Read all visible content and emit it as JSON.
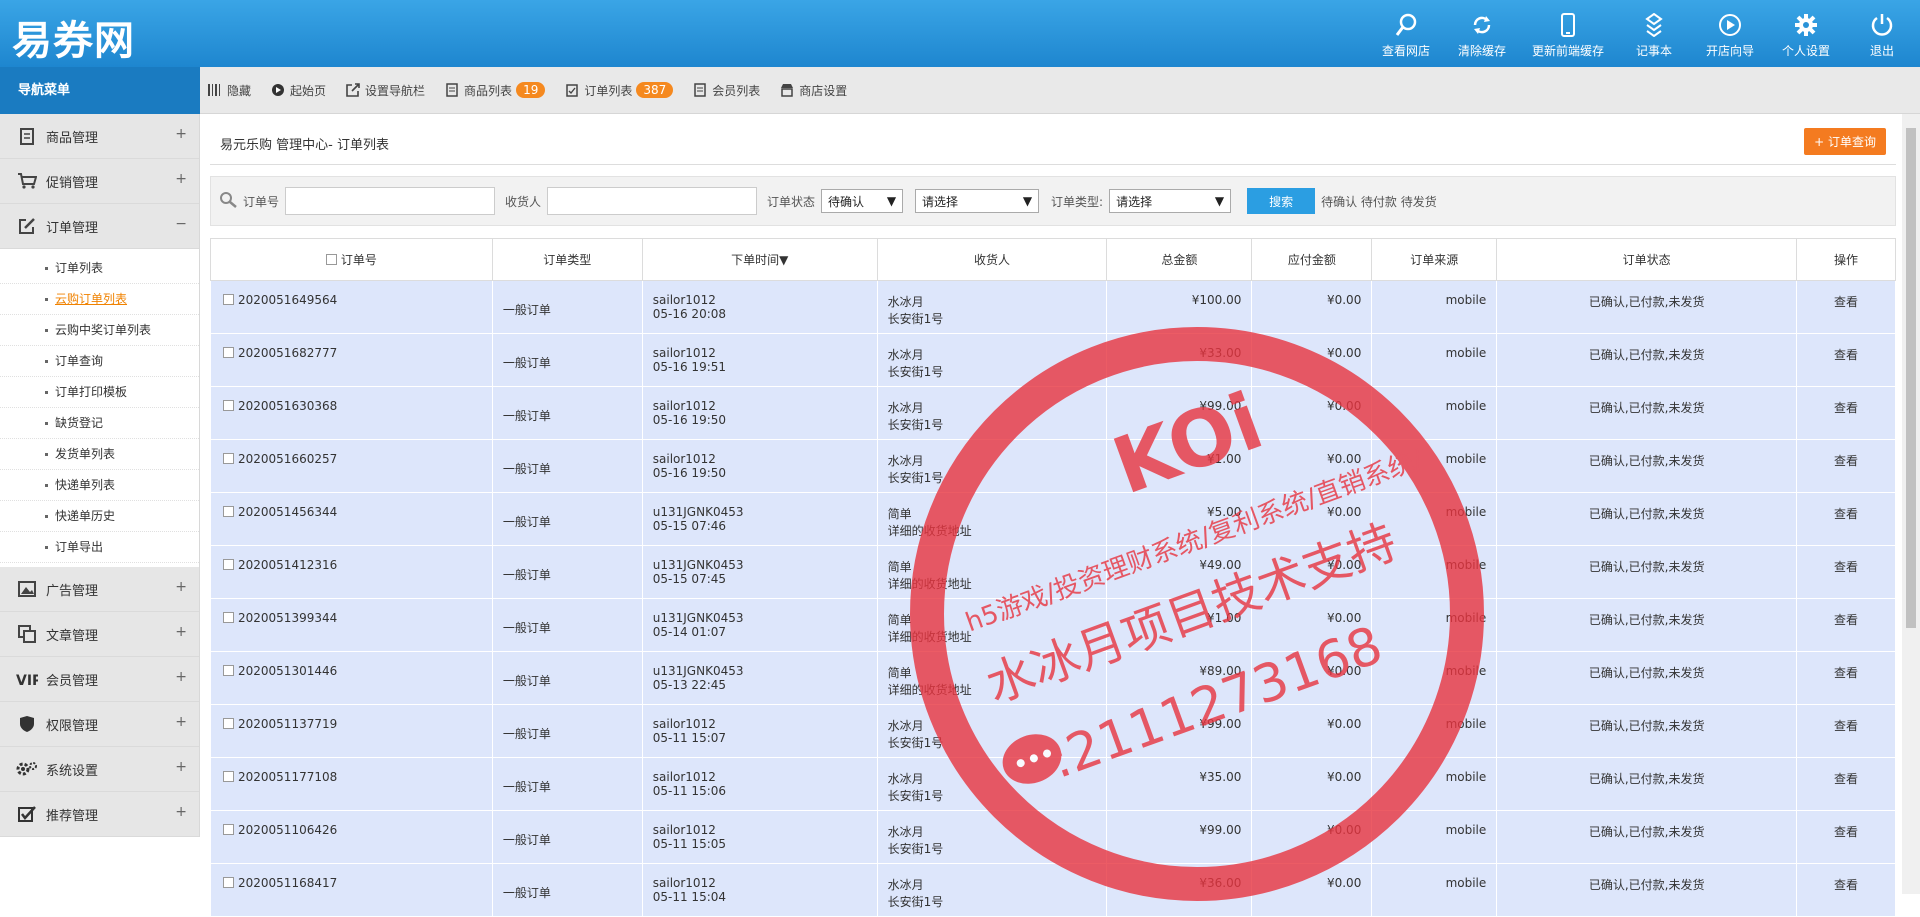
{
  "app": {
    "logo": "易券网"
  },
  "topnav": [
    {
      "label": "查看网店",
      "icon": "search-icon"
    },
    {
      "label": "清除缓存",
      "icon": "refresh-icon"
    },
    {
      "label": "更新前端缓存",
      "icon": "mobile-icon"
    },
    {
      "label": "记事本",
      "icon": "note-icon"
    },
    {
      "label": "开店向导",
      "icon": "play-icon"
    },
    {
      "label": "个人设置",
      "icon": "gear-icon"
    },
    {
      "label": "退出",
      "icon": "power-icon"
    }
  ],
  "sidebar": {
    "title": "导航菜单",
    "items": [
      {
        "label": "商品管理",
        "toggle": "+"
      },
      {
        "label": "促销管理",
        "toggle": "+"
      },
      {
        "label": "订单管理",
        "toggle": "−"
      },
      {
        "label": "广告管理",
        "toggle": "+"
      },
      {
        "label": "文章管理",
        "toggle": "+"
      },
      {
        "label": "会员管理",
        "toggle": "+"
      },
      {
        "label": "权限管理",
        "toggle": "+"
      },
      {
        "label": "系统设置",
        "toggle": "+"
      },
      {
        "label": "推荐管理",
        "toggle": "+"
      }
    ],
    "order_sub": [
      "订单列表",
      "云购订单列表",
      "云购中奖订单列表",
      "订单查询",
      "订单打印模板",
      "缺货登记",
      "发货单列表",
      "快递单列表",
      "快递单历史",
      "订单导出"
    ],
    "active_sub": "云购订单列表"
  },
  "tabs": [
    {
      "label": "隐藏"
    },
    {
      "label": "起始页"
    },
    {
      "label": "设置导航栏"
    },
    {
      "label": "商品列表",
      "badge": "19"
    },
    {
      "label": "订单列表",
      "badge": "387"
    },
    {
      "label": "会员列表"
    },
    {
      "label": "商店设置"
    }
  ],
  "page": {
    "breadcrumb": "易元乐购 管理中心- 订单列表",
    "query_button": "+ 订单查询"
  },
  "filter": {
    "order_no_label": "订单号",
    "consignee_label": "收货人",
    "status_label": "订单状态",
    "status_value": "待确认",
    "select2_value": "请选择",
    "type_label": "订单类型:",
    "type_value": "请选择",
    "search_button": "搜索",
    "quick_links": "待确认 待付款 待发货"
  },
  "table": {
    "headers": [
      "订单号",
      "订单类型",
      "下单时间▼",
      "收货人",
      "总金额",
      "应付金额",
      "订单来源",
      "订单状态",
      "操作"
    ],
    "rows": [
      {
        "no": "2020051649564",
        "type": "一般订单",
        "user": "sailor1012",
        "time": "05-16 20:08",
        "name": "水冰月",
        "addr": "长安街1号",
        "total": "¥100.00",
        "due": "¥0.00",
        "src": "mobile",
        "status": "已确认,已付款,未发货",
        "op": "查看"
      },
      {
        "no": "2020051682777",
        "type": "一般订单",
        "user": "sailor1012",
        "time": "05-16 19:51",
        "name": "水冰月",
        "addr": "长安街1号",
        "total": "¥33.00",
        "due": "¥0.00",
        "src": "mobile",
        "status": "已确认,已付款,未发货",
        "op": "查看"
      },
      {
        "no": "2020051630368",
        "type": "一般订单",
        "user": "sailor1012",
        "time": "05-16 19:50",
        "name": "水冰月",
        "addr": "长安街1号",
        "total": "¥99.00",
        "due": "¥0.00",
        "src": "mobile",
        "status": "已确认,已付款,未发货",
        "op": "查看"
      },
      {
        "no": "2020051660257",
        "type": "一般订单",
        "user": "sailor1012",
        "time": "05-16 19:50",
        "name": "水冰月",
        "addr": "长安街1号",
        "total": "¥1.00",
        "due": "¥0.00",
        "src": "mobile",
        "status": "已确认,已付款,未发货",
        "op": "查看"
      },
      {
        "no": "2020051456344",
        "type": "一般订单",
        "user": "u131JGNK0453",
        "time": "05-15 07:46",
        "name": "简单",
        "addr": "详细的收货地址",
        "total": "¥5.00",
        "due": "¥0.00",
        "src": "mobile",
        "status": "已确认,已付款,未发货",
        "op": "查看"
      },
      {
        "no": "2020051412316",
        "type": "一般订单",
        "user": "u131JGNK0453",
        "time": "05-15 07:45",
        "name": "简单",
        "addr": "详细的收货地址",
        "total": "¥49.00",
        "due": "¥0.00",
        "src": "mobile",
        "status": "已确认,已付款,未发货",
        "op": "查看"
      },
      {
        "no": "2020051399344",
        "type": "一般订单",
        "user": "u131JGNK0453",
        "time": "05-14 01:07",
        "name": "简单",
        "addr": "详细的收货地址",
        "total": "¥1.00",
        "due": "¥0.00",
        "src": "mobile",
        "status": "已确认,已付款,未发货",
        "op": "查看"
      },
      {
        "no": "2020051301446",
        "type": "一般订单",
        "user": "u131JGNK0453",
        "time": "05-13 22:45",
        "name": "简单",
        "addr": "详细的收货地址",
        "total": "¥89.00",
        "due": "¥0.00",
        "src": "mobile",
        "status": "已确认,已付款,未发货",
        "op": "查看"
      },
      {
        "no": "2020051137719",
        "type": "一般订单",
        "user": "sailor1012",
        "time": "05-11 15:07",
        "name": "水冰月",
        "addr": "长安街1号",
        "total": "¥99.00",
        "due": "¥0.00",
        "src": "mobile",
        "status": "已确认,已付款,未发货",
        "op": "查看"
      },
      {
        "no": "2020051177108",
        "type": "一般订单",
        "user": "sailor1012",
        "time": "05-11 15:06",
        "name": "水冰月",
        "addr": "长安街1号",
        "total": "¥35.00",
        "due": "¥0.00",
        "src": "mobile",
        "status": "已确认,已付款,未发货",
        "op": "查看"
      },
      {
        "no": "2020051106426",
        "type": "一般订单",
        "user": "sailor1012",
        "time": "05-11 15:05",
        "name": "水冰月",
        "addr": "长安街1号",
        "total": "¥99.00",
        "due": "¥0.00",
        "src": "mobile",
        "status": "已确认,已付款,未发货",
        "op": "查看"
      },
      {
        "no": "2020051168417",
        "type": "一般订单",
        "user": "sailor1012",
        "time": "05-11 15:04",
        "name": "水冰月",
        "addr": "长安街1号",
        "total": "¥36.00",
        "due": "¥0.00",
        "src": "mobile",
        "status": "已确认,已付款,未发货",
        "op": "查看"
      }
    ]
  },
  "watermark": {
    "brand": "KOi",
    "line1": "h5游戏/投资理财系统/复利系统/直销系统/",
    "line2": "水冰月项目技术支持",
    "line3": ":2111273168",
    "color": "#e8343f"
  }
}
